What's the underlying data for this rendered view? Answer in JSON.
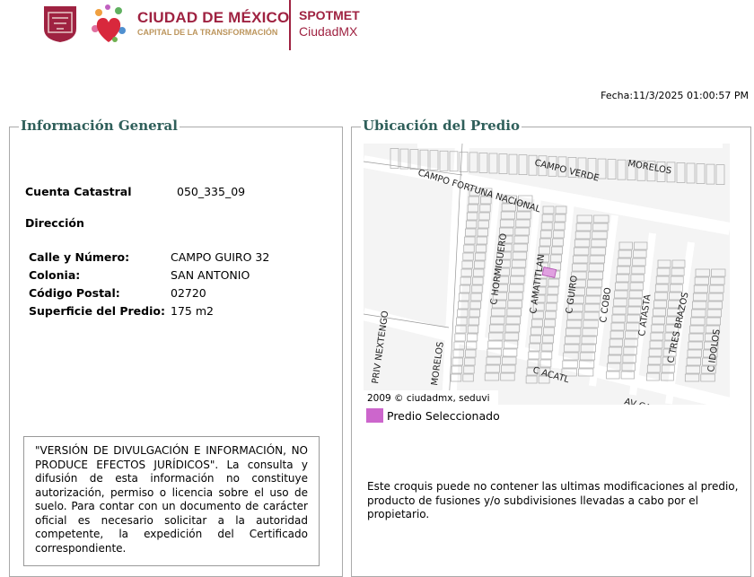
{
  "header": {
    "brand_title": "CIUDAD DE MÉXICO",
    "brand_subtitle": "CAPITAL DE LA TRANSFORMACIÓN",
    "app_name_1": "SPOTMET",
    "app_name_2": "CiudadMX",
    "colors": {
      "brand": "#9f2241",
      "gold": "#bc955c"
    }
  },
  "fecha": "Fecha:11/3/2025 01:00:57 PM",
  "info": {
    "title": "Información General",
    "cuenta_label": "Cuenta Catastral",
    "cuenta_value": "050_335_09",
    "direccion_label": "Dirección",
    "rows": [
      {
        "label": "Calle y Número:",
        "value": "CAMPO GUIRO 32"
      },
      {
        "label": "Colonia:",
        "value": "SAN ANTONIO"
      },
      {
        "label": "Código Postal:",
        "value": "02720"
      },
      {
        "label": "Superficie del Predio:",
        "value": "175 m2"
      }
    ],
    "disclaimer": "\"VERSIÓN DE DIVULGACIÓN E INFORMACIÓN, NO PRODUCE EFECTOS JURÍDICOS\". La consulta y difusión de esta información no constituye autorización, permiso o licencia sobre el uso de suelo. Para contar con un documento de carácter oficial es necesario solicitar a la autoridad competente, la expedición del Certificado correspondiente."
  },
  "map": {
    "title": "Ubicación del Predio",
    "copyright": "2009 © ciudadmx, seduvi",
    "legend_label": "Predio Seleccionado",
    "legend_color": "#cc66cc",
    "street_labels": [
      "CAMPO VERDE",
      "MORELOS",
      "CAMPO FORTUNA NACIONAL",
      "C HORMIGUERO",
      "C AMATITLAN",
      "C GUIRO",
      "C COBO",
      "C ATASTA",
      "C TRES BRAZOS",
      "C IDOLOS",
      "PRIV NEXTENGO",
      "MORELOS",
      "C ACATL",
      "AV CA"
    ],
    "note": "Este croquis puede no contener las ultimas modificaciones al predio, producto de fusiones y/o subdivisiones llevadas a cabo por el propietario."
  }
}
